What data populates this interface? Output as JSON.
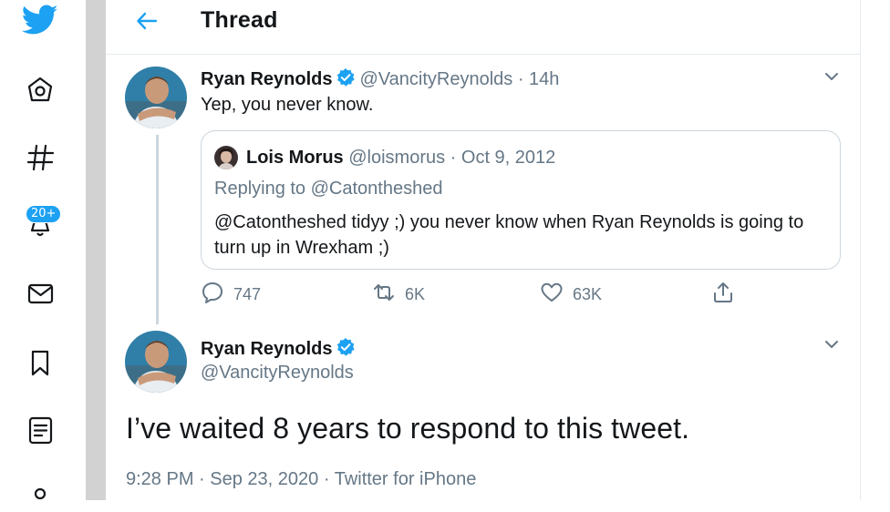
{
  "sidebar": {
    "badge": "20+",
    "items": [
      {
        "icon": "twitter-bird-icon"
      },
      {
        "icon": "home-icon"
      },
      {
        "icon": "explore-hashtag-icon"
      },
      {
        "icon": "notifications-bell-icon"
      },
      {
        "icon": "messages-mail-icon"
      },
      {
        "icon": "bookmarks-icon"
      },
      {
        "icon": "lists-icon"
      },
      {
        "icon": "profile-icon"
      }
    ]
  },
  "header": {
    "title": "Thread"
  },
  "colors": {
    "accent": "#1da1f2",
    "text": "#14171a",
    "muted": "#657786",
    "border": "#ccd6dd"
  },
  "tweet1": {
    "name": "Ryan Reynolds",
    "handle_time": "@VancityReynolds · 14h",
    "text": "Yep, you never know.",
    "quote": {
      "name": "Lois Morus",
      "handle_date": "@loismorus · Oct 9, 2012",
      "replying": "Replying to @Catontheshed",
      "text": "@Catontheshed tidyy ;) you never know when Ryan Reynolds is going to turn up in Wrexham ;)"
    },
    "stats": {
      "replies": "747",
      "retweets": "6K",
      "likes": "63K"
    }
  },
  "tweet2": {
    "name": "Ryan Reynolds",
    "handle": "@VancityReynolds",
    "text": "I’ve waited 8 years to respond to this tweet.",
    "time": "9:28 PM",
    "date": "Sep 23, 2020",
    "source": "Twitter for iPhone"
  }
}
